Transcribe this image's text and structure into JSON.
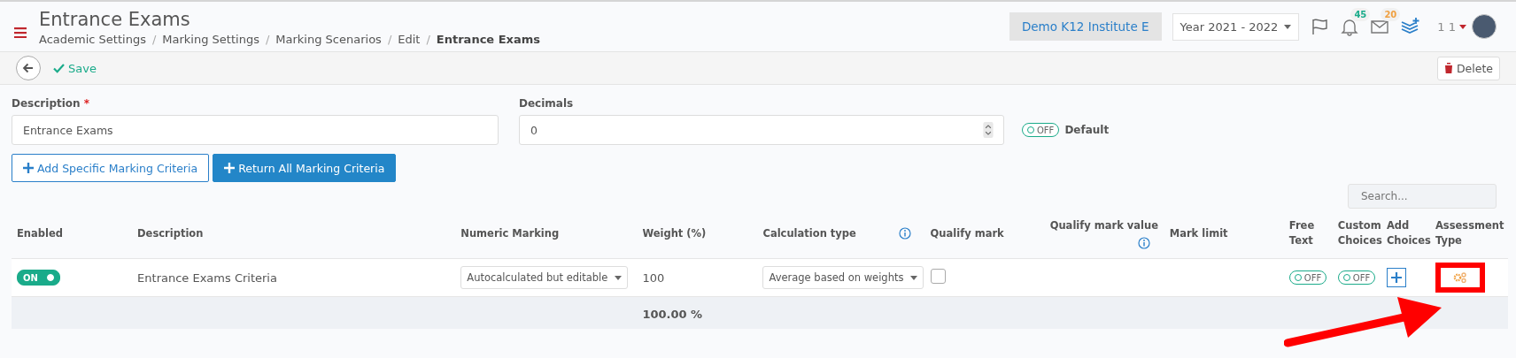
{
  "header": {
    "title": "Entrance Exams",
    "breadcrumb": [
      {
        "label": "Academic Settings",
        "current": false
      },
      {
        "label": "Marking Settings",
        "current": false
      },
      {
        "label": "Marking Scenarios",
        "current": false
      },
      {
        "label": "Edit",
        "current": false
      },
      {
        "label": "Entrance Exams",
        "current": true
      }
    ],
    "institute": "Demo K12 Institute E",
    "year": "Year 2021 - 2022",
    "separator": "/",
    "notifications": "45",
    "messages": "20",
    "user": "1 1"
  },
  "toolbar": {
    "save": "Save",
    "delete": "Delete"
  },
  "form": {
    "description_label": "Description",
    "required_mark": "*",
    "description_value": "Entrance Exams",
    "decimals_label": "Decimals",
    "decimals_value": "0",
    "default_toggle": {
      "on": false,
      "text": "OFF",
      "label": "Default"
    }
  },
  "buttons": [
    {
      "label": "Add Specific Marking Criteria",
      "kind": "outline"
    },
    {
      "label": "Return All Marking Criteria",
      "kind": "primary"
    }
  ],
  "search": {
    "placeholder": "Search..."
  },
  "table": {
    "columns": [
      {
        "label": "Enabled"
      },
      {
        "label": "Description"
      },
      {
        "label": "Numeric Marking"
      },
      {
        "label": "Weight (%)"
      },
      {
        "label": "Calculation type",
        "info": true
      },
      {
        "label": "Qualify mark"
      },
      {
        "label": "Qualify mark value",
        "info": true
      },
      {
        "label": "Mark limit"
      },
      {
        "label": "Free Text"
      },
      {
        "label": "Custom Choices"
      },
      {
        "label": "Add Choices"
      },
      {
        "label": "Assessment Type"
      }
    ],
    "rows": [
      {
        "enabled": {
          "on": true,
          "text": "ON"
        },
        "description": "Entrance Exams Criteria",
        "numeric_marking": "Autocalculated but editable",
        "weight": "100",
        "calculation_type": "Average based on weights",
        "qualify_mark": false,
        "free_text": {
          "on": false,
          "text": "OFF"
        },
        "custom_choices": {
          "on": false,
          "text": "OFF"
        }
      }
    ],
    "total_weight": "100.00 %"
  }
}
